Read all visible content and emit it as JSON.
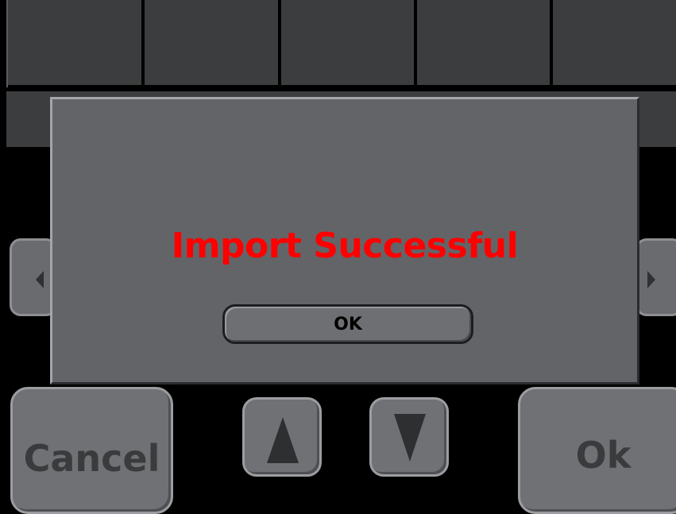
{
  "dialog": {
    "message": "Import Successful",
    "ok_label": "OK",
    "message_color": "#ff0000"
  },
  "footer": {
    "cancel_label": "Cancel",
    "ok_label": "Ok"
  },
  "icons": {
    "left": "chevron-left-icon",
    "right": "chevron-right-icon",
    "up": "arrow-up-icon",
    "down": "arrow-down-icon"
  }
}
